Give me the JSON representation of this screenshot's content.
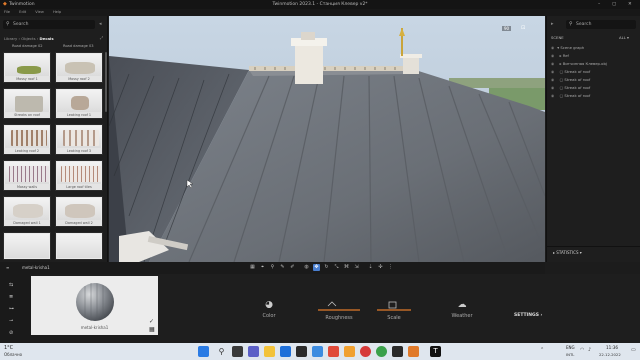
{
  "window": {
    "app_name": "Twinmotion",
    "title": "Twinmotion 2023.1 - Станция Клевер v2*",
    "menu": [
      "File",
      "Edit",
      "View",
      "Help"
    ]
  },
  "library": {
    "search_placeholder": "Search",
    "breadcrumb": [
      "Library",
      "Objects",
      "Decals"
    ],
    "header_left": "Road damage 02",
    "header_right": "Road damage 03",
    "items": [
      {
        "label": "Mossy roof 1"
      },
      {
        "label": "Mossy roof 2"
      },
      {
        "label": "Streaks on roof"
      },
      {
        "label": "Leaking roof 1"
      },
      {
        "label": "Leaking roof 2"
      },
      {
        "label": "Leaking roof 3"
      },
      {
        "label": "Mossy walls"
      },
      {
        "label": "Large roof tiles"
      },
      {
        "label": "Damaged wall 1"
      },
      {
        "label": "Damaged wall 2"
      }
    ]
  },
  "scene": {
    "search_placeholder": "Search",
    "tab_label": "SCENE",
    "filter_label": "ALL",
    "rows": [
      {
        "label": "Scene graph"
      },
      {
        "label": "Ref"
      },
      {
        "label": "Витчинная Клевер.obj"
      },
      {
        "label": "Streak of roof"
      },
      {
        "label": "Streak of roof"
      },
      {
        "label": "Streak of roof"
      },
      {
        "label": "Streak of roof"
      }
    ],
    "statistics_label": "STATISTICS"
  },
  "viewport": {
    "zoom_readout": "90"
  },
  "material": {
    "name": "metal-krisha1",
    "preview_label": "metal-krisha1",
    "properties": [
      {
        "label": "Color",
        "icon": "color-icon"
      },
      {
        "label": "Roughness",
        "icon": "roughness-icon"
      },
      {
        "label": "Scale",
        "icon": "scale-icon"
      },
      {
        "label": "Weather",
        "icon": "weather-icon"
      }
    ],
    "settings_label": "SETTINGS"
  },
  "taskbar": {
    "weather_temp": "1°C",
    "weather_desc": "Облачно",
    "lang": "ENG",
    "lang_sub": "INTL",
    "time": "11:36",
    "date": "22.12.2022"
  },
  "colors": {
    "accent": "#e07a2a",
    "panel": "#1e1e1e"
  }
}
